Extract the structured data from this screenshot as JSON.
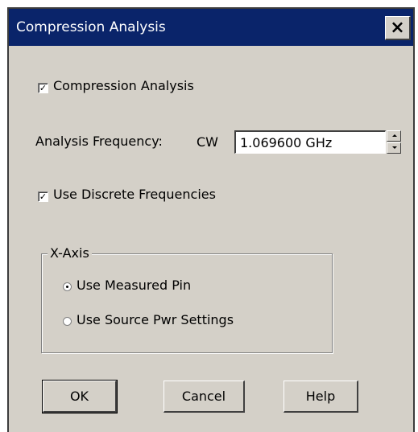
{
  "window": {
    "title": "Compression Analysis",
    "close_label": "×"
  },
  "compression": {
    "checked": true,
    "check_glyph": "✓",
    "label": "Compression Analysis"
  },
  "frequency": {
    "label": "Analysis Frequency:",
    "mode": "CW",
    "value": "1.069600 GHz"
  },
  "discrete": {
    "checked": true,
    "check_glyph": "✓",
    "label": "Use Discrete Frequencies"
  },
  "xaxis": {
    "legend": "X-Axis",
    "options": [
      {
        "label": "Use Measured Pin",
        "selected": true
      },
      {
        "label": "Use Source Pwr Settings",
        "selected": false
      }
    ]
  },
  "buttons": {
    "ok": "OK",
    "cancel": "Cancel",
    "help": "Help"
  }
}
